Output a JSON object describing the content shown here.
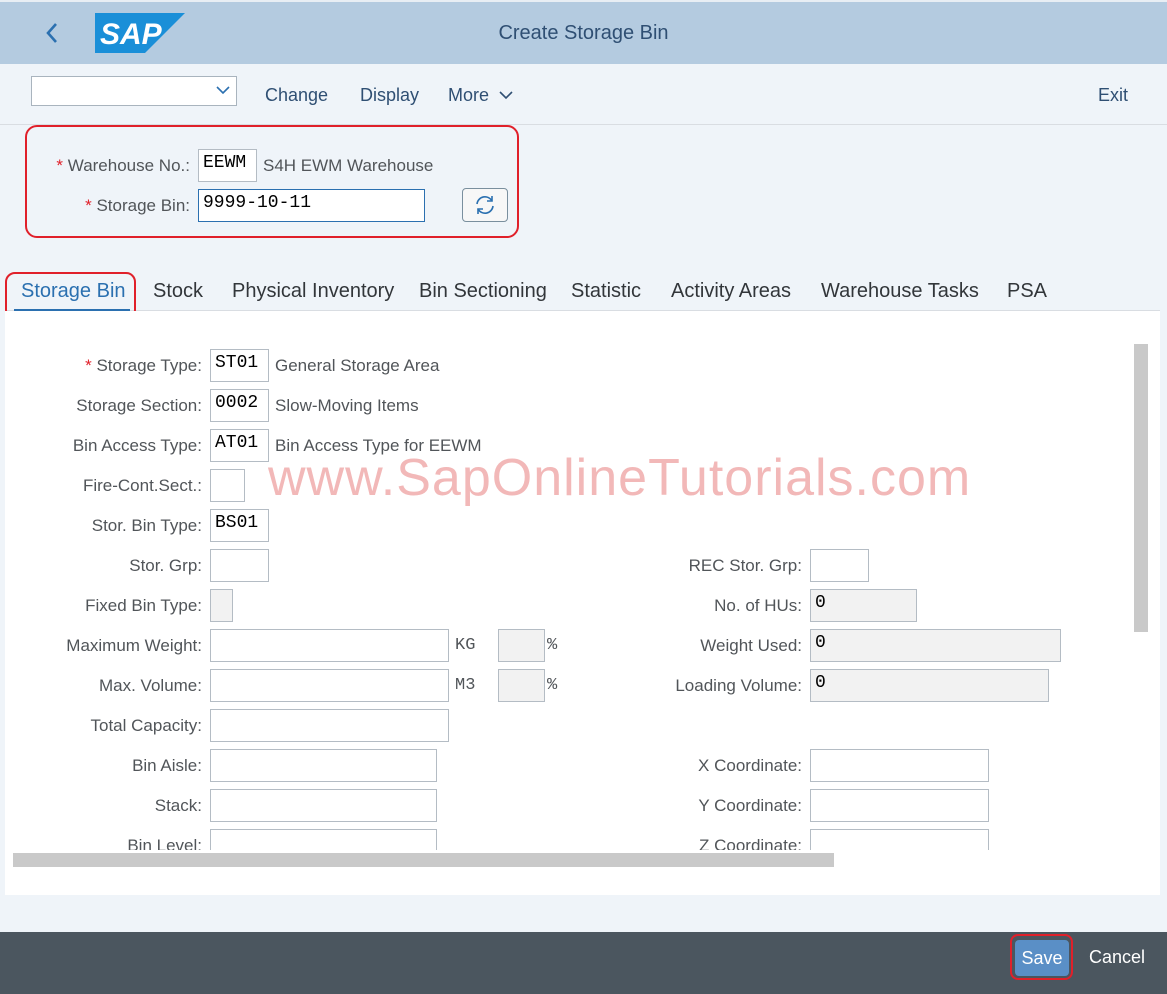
{
  "shell": {
    "title": "Create Storage Bin",
    "logo_text": "SAP"
  },
  "toolbar": {
    "variant_value": "",
    "change": "Change",
    "display": "Display",
    "more": "More",
    "exit": "Exit"
  },
  "header": {
    "warehouse_label": "Warehouse No.:",
    "warehouse_value": "EEWM",
    "warehouse_desc": "S4H EWM Warehouse",
    "storage_bin_label": "Storage Bin:",
    "storage_bin_value": "9999-10-11"
  },
  "tabs": [
    {
      "label": "Storage Bin",
      "selected": true
    },
    {
      "label": "Stock"
    },
    {
      "label": "Physical Inventory"
    },
    {
      "label": "Bin Sectioning"
    },
    {
      "label": "Statistic"
    },
    {
      "label": "Activity Areas"
    },
    {
      "label": "Warehouse Tasks"
    },
    {
      "label": "PSA"
    }
  ],
  "form": {
    "storage_type": {
      "label": "Storage Type:",
      "value": "ST01",
      "desc": "General Storage Area"
    },
    "storage_section": {
      "label": "Storage Section:",
      "value": "0002",
      "desc": "Slow-Moving Items"
    },
    "bin_access_type": {
      "label": "Bin Access Type:",
      "value": "AT01",
      "desc": "Bin Access Type for EEWM"
    },
    "fire_cont_sect": {
      "label": "Fire-Cont.Sect.:",
      "value": ""
    },
    "stor_bin_type": {
      "label": "Stor. Bin Type:",
      "value": "BS01"
    },
    "stor_grp": {
      "label": "Stor. Grp:",
      "value": ""
    },
    "fixed_bin_type": {
      "label": "Fixed Bin Type:",
      "value": ""
    },
    "max_weight": {
      "label": "Maximum Weight:",
      "value": "",
      "unit": "KG",
      "pct": "",
      "pct_sign": "%"
    },
    "max_volume": {
      "label": "Max. Volume:",
      "value": "",
      "unit": "M3",
      "pct": "",
      "pct_sign": "%"
    },
    "total_capacity": {
      "label": "Total Capacity:",
      "value": ""
    },
    "bin_aisle": {
      "label": "Bin Aisle:",
      "value": ""
    },
    "stack": {
      "label": "Stack:",
      "value": ""
    },
    "bin_level": {
      "label": "Bin Level:",
      "value": ""
    },
    "rec_stor_grp": {
      "label": "REC Stor. Grp:",
      "value": ""
    },
    "no_of_hus": {
      "label": "No. of HUs:",
      "value": "0"
    },
    "weight_used": {
      "label": "Weight Used:",
      "value": "0"
    },
    "loading_volume": {
      "label": "Loading Volume:",
      "value": "0"
    },
    "x_coordinate": {
      "label": "X Coordinate:",
      "value": ""
    },
    "y_coordinate": {
      "label": "Y Coordinate:",
      "value": ""
    },
    "z_coordinate": {
      "label": "Z Coordinate:",
      "value": ""
    }
  },
  "watermark": "www.SapOnlineTutorials.com",
  "footer": {
    "save": "Save",
    "cancel": "Cancel"
  },
  "colors": {
    "shell_bg": "#b4cbe0",
    "accent": "#2b70b0",
    "highlight": "#e0202a",
    "footer_bg": "#4b565f",
    "save_bg": "#5a8fc6"
  }
}
